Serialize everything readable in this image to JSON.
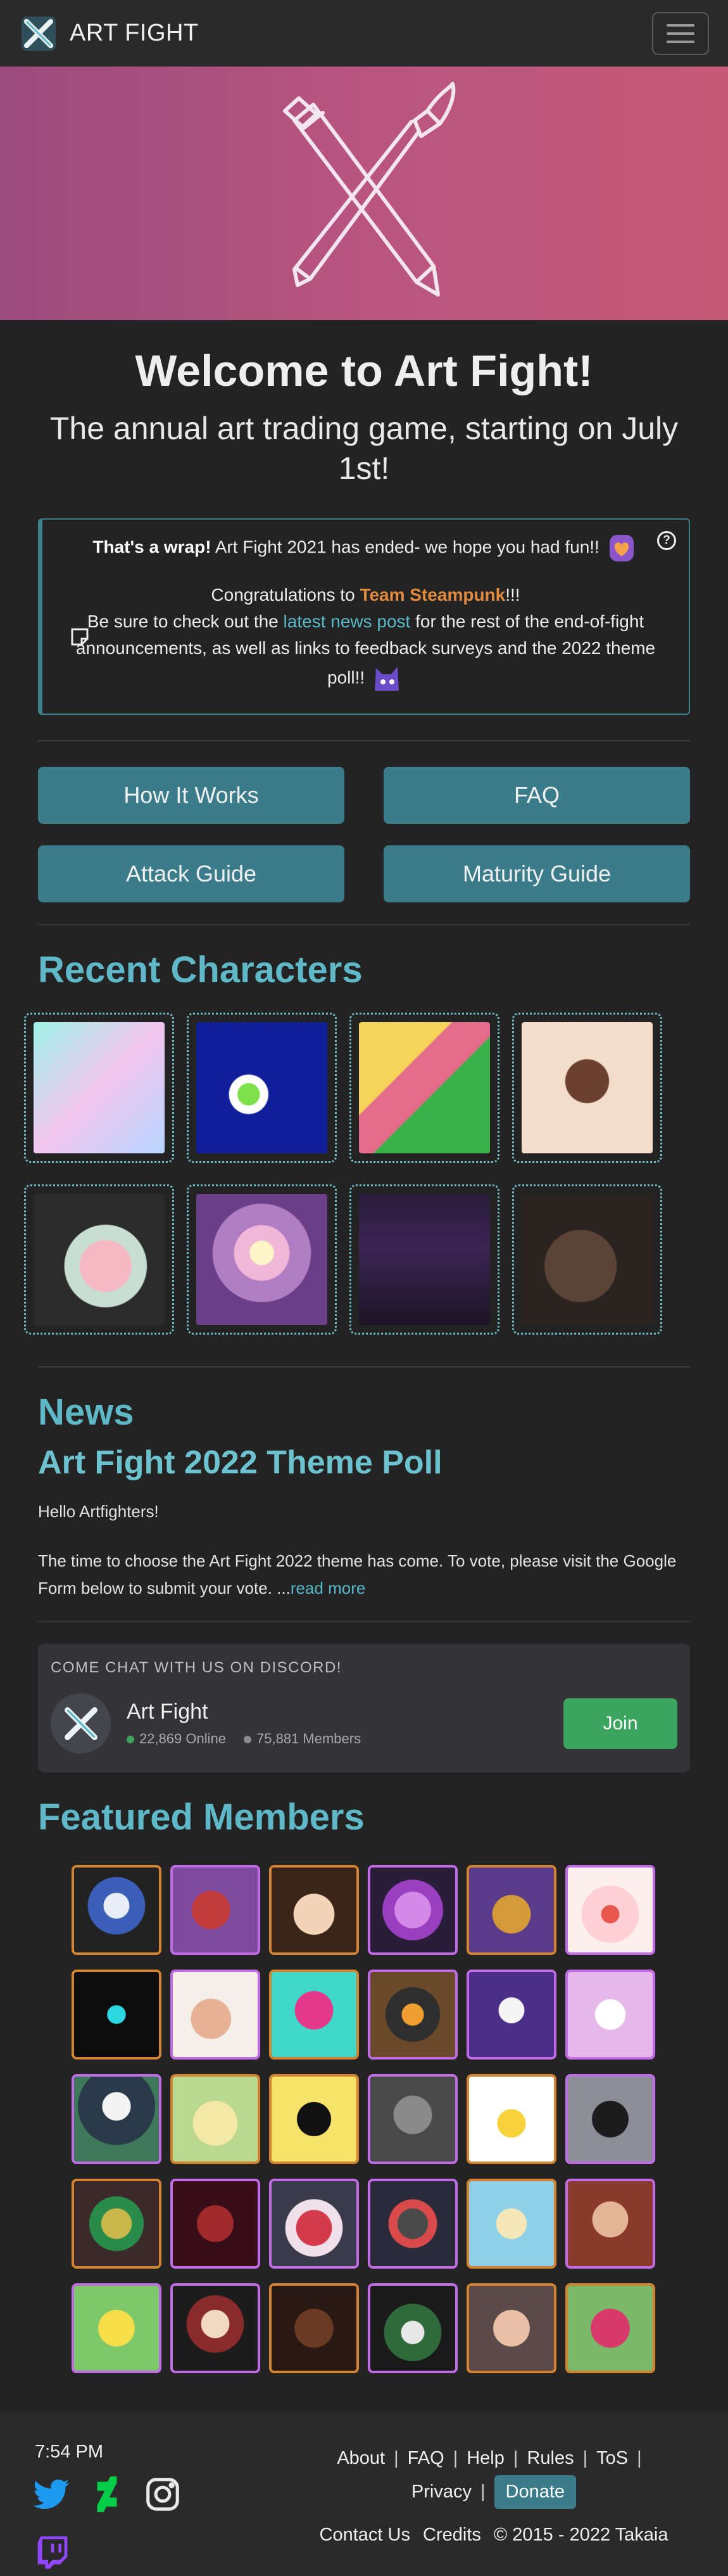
{
  "navbar": {
    "brand": "ART FIGHT",
    "menu_icon": "hamburger-icon"
  },
  "welcome": {
    "title": "Welcome to Art Fight!",
    "subtitle": "The annual art trading game, starting on July 1st!"
  },
  "announcement": {
    "wrap_bold": "That's a wrap!",
    "wrap_text": " Art Fight 2021 has ended- we hope you had fun!!",
    "congrats_pre": "Congratulations to ",
    "team": "Team Steampunk",
    "congrats_post": "!!!",
    "check_pre": "Be sure to check out the ",
    "news_link": "latest news post",
    "check_post": " for the rest of the end-of-fight announcements, as well as links to feedback surveys and the 2022 theme poll!!"
  },
  "buttons": [
    "How It Works",
    "FAQ",
    "Attack Guide",
    "Maturity Guide"
  ],
  "recent": {
    "title": "Recent Characters"
  },
  "news": {
    "section_title": "News",
    "post_title": "Art Fight 2022 Theme Poll",
    "greeting": "Hello Artfighters!",
    "excerpt": "The time to choose the Art Fight 2022 theme has come. To vote, please visit the Google Form below to submit your vote. ...",
    "read_more": "read more"
  },
  "discord": {
    "header": "COME CHAT WITH US ON DISCORD!",
    "server_name": "Art Fight",
    "online": "22,869 Online",
    "members": "75,881 Members",
    "join": "Join",
    "online_color": "#3ba55d",
    "members_color": "#8a8a8a"
  },
  "featured": {
    "title": "Featured Members"
  },
  "footer": {
    "time": "7:54 PM",
    "links": [
      "About",
      "FAQ",
      "Help",
      "Rules",
      "ToS",
      "Privacy"
    ],
    "donate": "Donate",
    "contact": "Contact Us",
    "credits": "Credits",
    "copyright": "© 2015 - 2022 Takaia",
    "socials": [
      "twitter-icon",
      "deviantart-icon",
      "instagram-icon",
      "twitch-icon"
    ]
  },
  "colors": {
    "accent": "#5fb8c7",
    "button": "#3b7c8a",
    "team": "#e28a3e",
    "hero_gradient": [
      "#9a4c7c",
      "#c55a78"
    ]
  }
}
